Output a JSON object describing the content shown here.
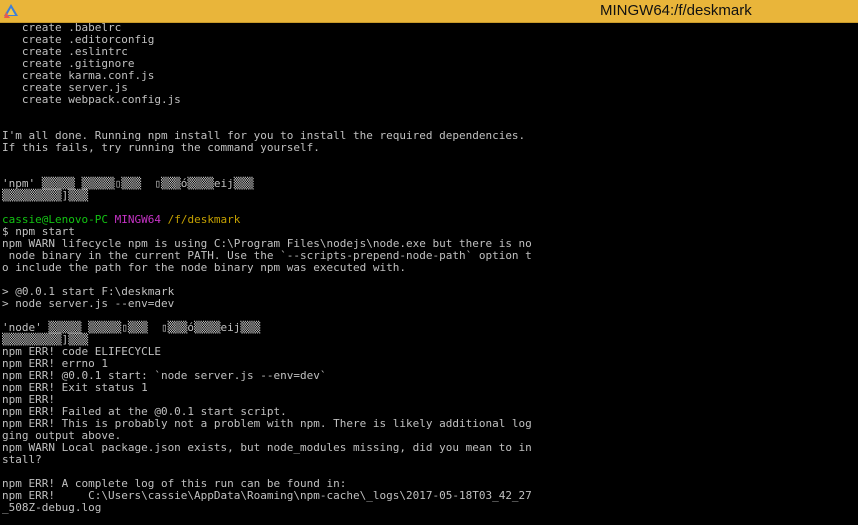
{
  "window": {
    "title": "MINGW64:/f/deskmark",
    "icon": "mingw-terminal-icon",
    "colors": {
      "titlebar": "#e9b53a",
      "background": "#000000",
      "text": "#c0c0c0",
      "user": "#13c313",
      "system": "#c633c6",
      "path": "#c4a000"
    }
  },
  "terminal": {
    "lines": [
      "   create .babelrc",
      "   create .editorconfig",
      "   create .eslintrc",
      "   create .gitignore",
      "   create karma.conf.js",
      "   create server.js",
      "   create webpack.config.js",
      "",
      "",
      "I'm all done. Running npm install for you to install the required dependencies.",
      "If this fails, try running the command yourself.",
      "",
      "",
      "'npm' ▒▒▒▒▒ ▒▒▒▒▒▯▒▒▒  ▯▒▒▒ó▒▒▒▒eij▒▒▒",
      "▒▒▒▒▒▒▒▒▒]▒▒▒",
      "",
      null,
      "$ npm start",
      "npm WARN lifecycle npm is using C:\\Program Files\\nodejs\\node.exe but there is no",
      " node binary in the current PATH. Use the `--scripts-prepend-node-path` option t",
      "o include the path for the node binary npm was executed with.",
      "",
      "> @0.0.1 start F:\\deskmark",
      "> node server.js --env=dev",
      "",
      "'node' ▒▒▒▒▒ ▒▒▒▒▒▯▒▒▒  ▯▒▒▒ó▒▒▒▒eij▒▒▒",
      "▒▒▒▒▒▒▒▒▒]▒▒▒",
      "npm ERR! code ELIFECYCLE",
      "npm ERR! errno 1",
      "npm ERR! @0.0.1 start: `node server.js --env=dev`",
      "npm ERR! Exit status 1",
      "npm ERR!",
      "npm ERR! Failed at the @0.0.1 start script.",
      "npm ERR! This is probably not a problem with npm. There is likely additional log",
      "ging output above.",
      "npm WARN Local package.json exists, but node_modules missing, did you mean to in",
      "stall?",
      "",
      "npm ERR! A complete log of this run can be found in:",
      "npm ERR!     C:\\Users\\cassie\\AppData\\Roaming\\npm-cache\\_logs\\2017-05-18T03_42_27",
      "_508Z-debug.log"
    ],
    "prompt": {
      "user": "cassie@Lenovo-PC",
      "system": "MINGW64",
      "path": "/f/deskmark"
    }
  }
}
